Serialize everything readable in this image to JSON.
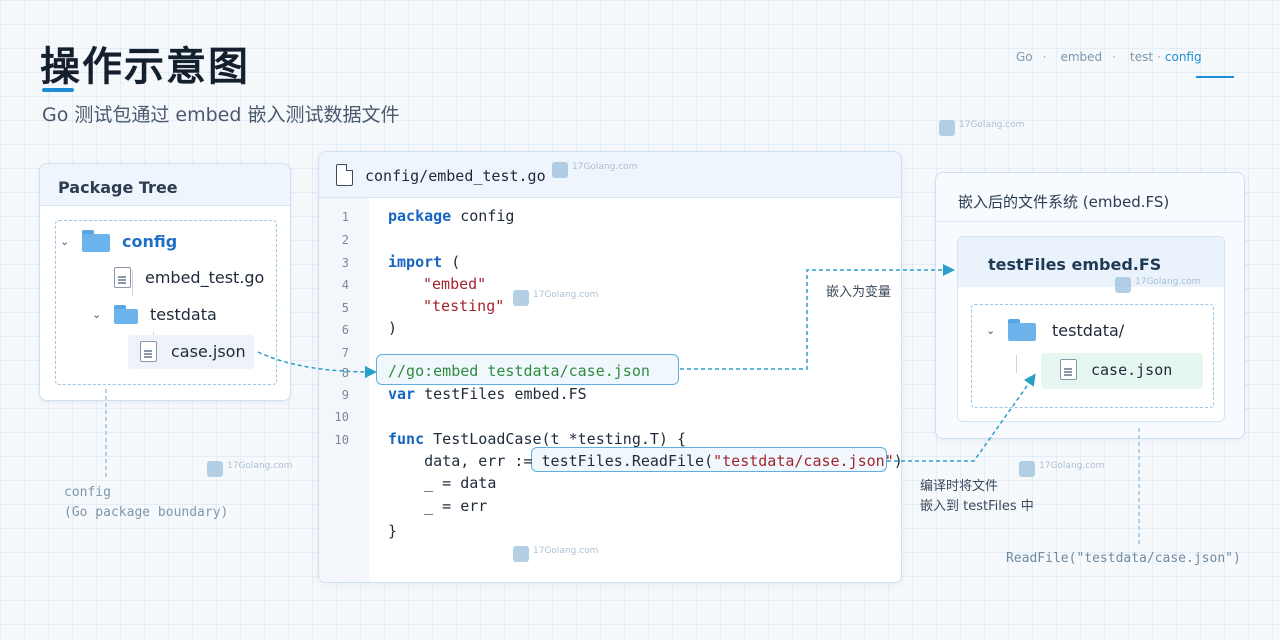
{
  "header": {
    "title": "操作示意图",
    "subtitle": "Go 测试包通过 embed 嵌入测试数据文件",
    "nav": [
      "Go",
      "embed",
      "test",
      "config"
    ],
    "nav_sep": "·",
    "nav_active": "config"
  },
  "watermark": {
    "text": "17Golang.com"
  },
  "package_tree": {
    "title": "Package Tree",
    "items": [
      {
        "label": "config",
        "type": "folder"
      },
      {
        "label": "embed_test.go",
        "type": "file"
      },
      {
        "label": "testdata",
        "type": "folder"
      },
      {
        "label": "case.json",
        "type": "file"
      }
    ],
    "footnote_line1": "config",
    "footnote_line2": "(Go package boundary)"
  },
  "code": {
    "filename": "config/embed_test.go",
    "line_numbers": [
      "1",
      "2",
      "3",
      "4",
      "5",
      "6",
      "7",
      "8",
      "9",
      "10"
    ],
    "lines": {
      "l1_kw": "package",
      "l1_rest": " config",
      "l3_kw": "import",
      "l3_rest": " (",
      "l4": "\"embed\"",
      "l5": "\"testing\"",
      "l6": ")",
      "l8_comment": "//go:embed testdata/case.json",
      "l9_kw": "var",
      "l9_rest": " testFiles embed.FS",
      "l10_kw": "func",
      "l10_rest": " TestLoadCase(t *testing.T) {",
      "l11_pre": "    data, err := ",
      "l11_call": "testFiles.ReadFile(",
      "l11_str": "\"testdata/case.json\"",
      "l11_close": ")",
      "l12": "    _ = data",
      "l13": "    _ = err",
      "l14": "}"
    }
  },
  "embedded_fs": {
    "title": "嵌入后的文件系统 (embed.FS)",
    "var_label": "testFiles embed.FS",
    "folder": "testdata/",
    "file": "case.json",
    "readfile_note": "ReadFile(\"testdata/case.json\")"
  },
  "annotations": {
    "embed_var": "嵌入为变量",
    "compile_line1": "编译时将文件",
    "compile_line2": "嵌入到 testFiles 中"
  },
  "colors": {
    "accent": "#1f8dd6",
    "arrow": "#2aa0c8",
    "keyword": "#1565c0",
    "string": "#a3262e",
    "comment": "#2e8b3e"
  }
}
